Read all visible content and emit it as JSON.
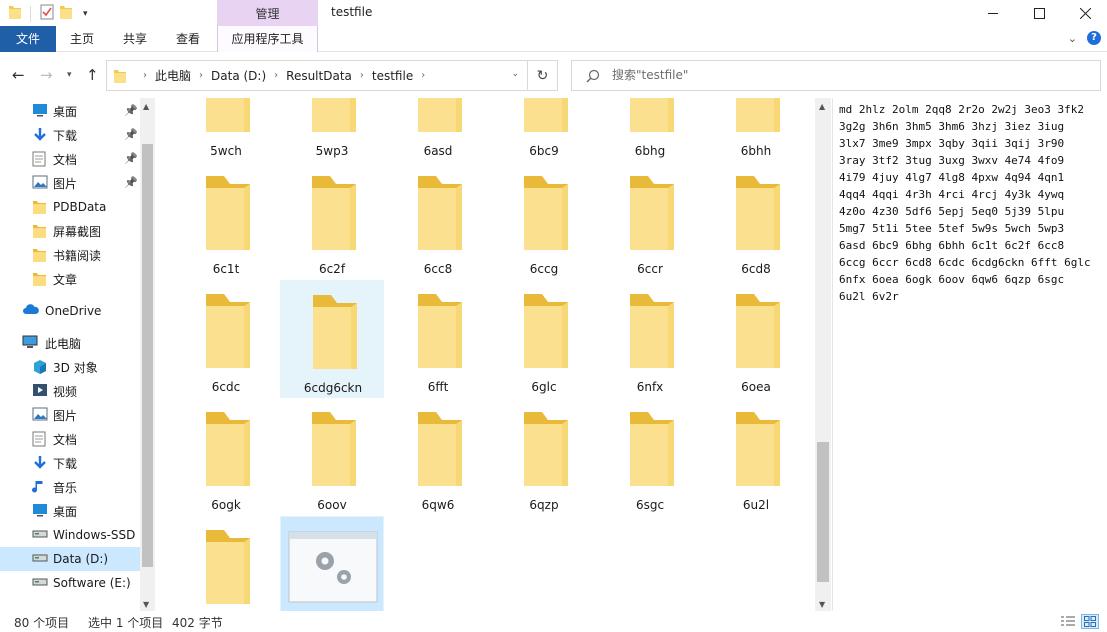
{
  "window": {
    "title": "testfile",
    "context_tab_header": "管理"
  },
  "ribbon": {
    "tabs": {
      "file": "文件",
      "home": "主页",
      "share": "共享",
      "view": "查看",
      "app_tools": "应用程序工具"
    }
  },
  "address": {
    "crumbs": [
      "此电脑",
      "Data (D:)",
      "ResultData",
      "testfile"
    ],
    "search_placeholder": "搜索\"testfile\""
  },
  "nav": {
    "quick_access": [
      {
        "label": "桌面",
        "icon": "desktop-icon",
        "pinned": true
      },
      {
        "label": "下载",
        "icon": "download-icon",
        "pinned": true
      },
      {
        "label": "文档",
        "icon": "document-icon",
        "pinned": true
      },
      {
        "label": "图片",
        "icon": "picture-icon",
        "pinned": true
      },
      {
        "label": "PDBData",
        "icon": "folder-icon",
        "pinned": false
      },
      {
        "label": "屏幕截图",
        "icon": "folder-icon",
        "pinned": false
      },
      {
        "label": "书籍阅读",
        "icon": "folder-icon",
        "pinned": false
      },
      {
        "label": "文章",
        "icon": "folder-icon",
        "pinned": false
      }
    ],
    "onedrive": "OneDrive",
    "this_pc": "此电脑",
    "pc_items": [
      {
        "label": "3D 对象",
        "icon": "3d-objects-icon"
      },
      {
        "label": "视频",
        "icon": "video-icon"
      },
      {
        "label": "图片",
        "icon": "picture-icon"
      },
      {
        "label": "文档",
        "icon": "document-icon"
      },
      {
        "label": "下载",
        "icon": "download-icon"
      },
      {
        "label": "音乐",
        "icon": "music-icon"
      },
      {
        "label": "桌面",
        "icon": "desktop-icon"
      },
      {
        "label": "Windows-SSD",
        "icon": "drive-icon"
      },
      {
        "label": "Data (D:)",
        "icon": "drive-icon",
        "selected": true
      },
      {
        "label": "Software (E:)",
        "icon": "drive-icon"
      }
    ]
  },
  "files": [
    {
      "name": "5wch",
      "type": "folder"
    },
    {
      "name": "5wp3",
      "type": "folder"
    },
    {
      "name": "6asd",
      "type": "folder"
    },
    {
      "name": "6bc9",
      "type": "folder"
    },
    {
      "name": "6bhg",
      "type": "folder"
    },
    {
      "name": "6bhh",
      "type": "folder"
    },
    {
      "name": "6c1t",
      "type": "folder"
    },
    {
      "name": "6c2f",
      "type": "folder"
    },
    {
      "name": "6cc8",
      "type": "folder"
    },
    {
      "name": "6ccg",
      "type": "folder"
    },
    {
      "name": "6ccr",
      "type": "folder"
    },
    {
      "name": "6cd8",
      "type": "folder"
    },
    {
      "name": "6cdc",
      "type": "folder"
    },
    {
      "name": "6cdg6ckn",
      "type": "folder",
      "hover": true
    },
    {
      "name": "6fft",
      "type": "folder"
    },
    {
      "name": "6glc",
      "type": "folder"
    },
    {
      "name": "6nfx",
      "type": "folder"
    },
    {
      "name": "6oea",
      "type": "folder"
    },
    {
      "name": "6ogk",
      "type": "folder"
    },
    {
      "name": "6oov",
      "type": "folder"
    },
    {
      "name": "6qw6",
      "type": "folder"
    },
    {
      "name": "6qzp",
      "type": "folder"
    },
    {
      "name": "6sgc",
      "type": "folder"
    },
    {
      "name": "6u2l",
      "type": "folder"
    },
    {
      "name": "",
      "type": "folder"
    },
    {
      "name": "",
      "type": "application",
      "selected": true
    }
  ],
  "preview_text": "md 2hlz 2olm 2qq8 2r2o 2w2j 3eo3 3fk2\n3g2g 3h6n 3hm5 3hm6 3hzj 3iez 3iug\n3lx7 3me9 3mpx 3qby 3qii 3qij 3r90\n3ray 3tf2 3tug 3uxg 3wxv 4e74 4fo9\n4i79 4juy 4lg7 4lg8 4pxw 4q94 4qn1\n4qq4 4qqi 4r3h 4rci 4rcj 4y3k 4ywq\n4z0o 4z30 5df6 5epj 5eq0 5j39 5lpu\n5mg7 5t1i 5tee 5tef 5w9s 5wch 5wp3\n6asd 6bc9 6bhg 6bhh 6c1t 6c2f 6cc8\n6ccg 6ccr 6cd8 6cdc 6cdg6ckn 6fft 6glc\n6nfx 6oea 6ogk 6oov 6qw6 6qzp 6sgc\n6u2l 6v2r",
  "status": {
    "count": "80 个项目",
    "selection": "选中 1 个项目",
    "size": "402 字节"
  },
  "colors": {
    "file_tab": "#1f5fa8",
    "context_tab": "#e8d3f2",
    "selection": "#cce8ff",
    "folder": "#f5d67b"
  }
}
